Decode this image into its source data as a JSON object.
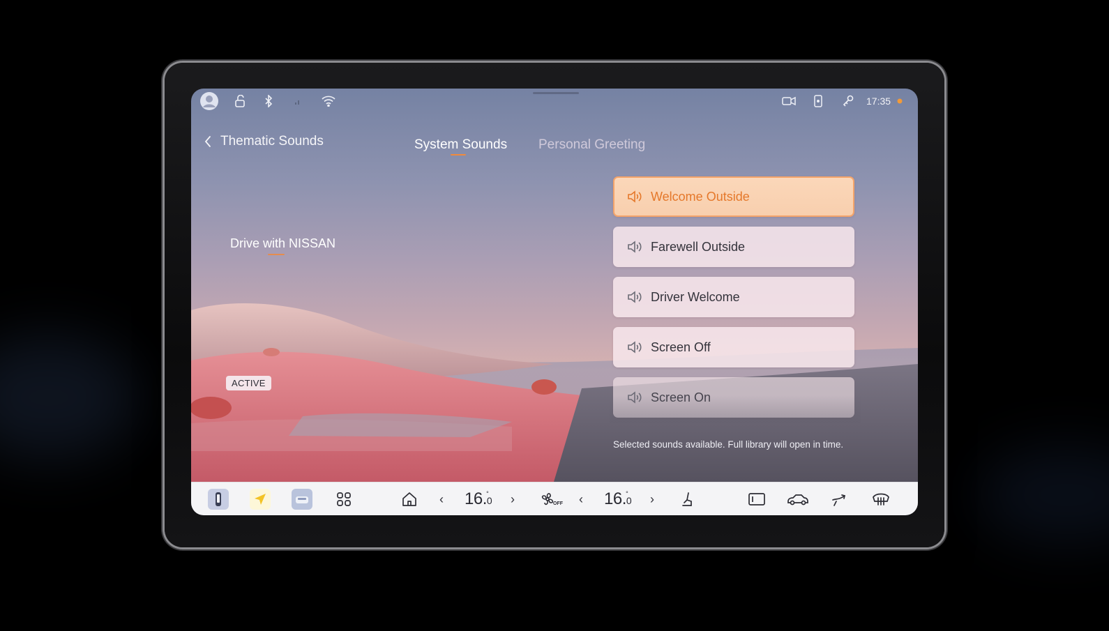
{
  "status_bar": {
    "time": "17:35",
    "icons": [
      "avatar-icon",
      "lock-open-icon",
      "bluetooth-icon",
      "signal-icon",
      "wifi-icon",
      "dashcam-icon",
      "phone-key-icon",
      "key-icon",
      "notification-dot-icon"
    ],
    "notification_color": "#f29a38"
  },
  "header": {
    "title": "Thematic Sounds",
    "back_icon": "chevron-left-icon",
    "tabs": [
      {
        "label": "System Sounds",
        "active": true
      },
      {
        "label": "Personal Greeting",
        "active": false
      }
    ]
  },
  "theme_preview": {
    "brand_text": "Drive with NISSAN",
    "badge": "ACTIVE"
  },
  "sounds": {
    "items": [
      {
        "label": "Welcome Outside",
        "selected": true,
        "icon": "speaker-icon"
      },
      {
        "label": "Farewell Outside",
        "selected": false,
        "icon": "speaker-icon"
      },
      {
        "label": "Driver Welcome",
        "selected": false,
        "icon": "speaker-icon"
      },
      {
        "label": "Screen Off",
        "selected": false,
        "icon": "speaker-icon"
      },
      {
        "label": "Screen On",
        "selected": false,
        "icon": "speaker-icon"
      }
    ],
    "footnote": "Selected sounds available. Full library will open in time."
  },
  "dock": {
    "apps": [
      "phone-app-icon",
      "navigation-app-icon",
      "vehicle-app-icon",
      "app-grid-icon",
      "home-icon"
    ],
    "left_temp": {
      "whole": "16.",
      "decimal": "0",
      "unit": "°"
    },
    "fan": {
      "icon": "fan-icon",
      "state": "OFF"
    },
    "right_temp": {
      "whole": "16.",
      "decimal": "0",
      "unit": "°"
    },
    "controls": [
      "seat-heat-icon",
      "display-icon",
      "car-icon",
      "airflow-icon",
      "defrost-icon"
    ]
  },
  "colors": {
    "accent": "#f08a3c",
    "selected_card": "#f8cfae",
    "dock_bg": "#f4f4f6"
  }
}
